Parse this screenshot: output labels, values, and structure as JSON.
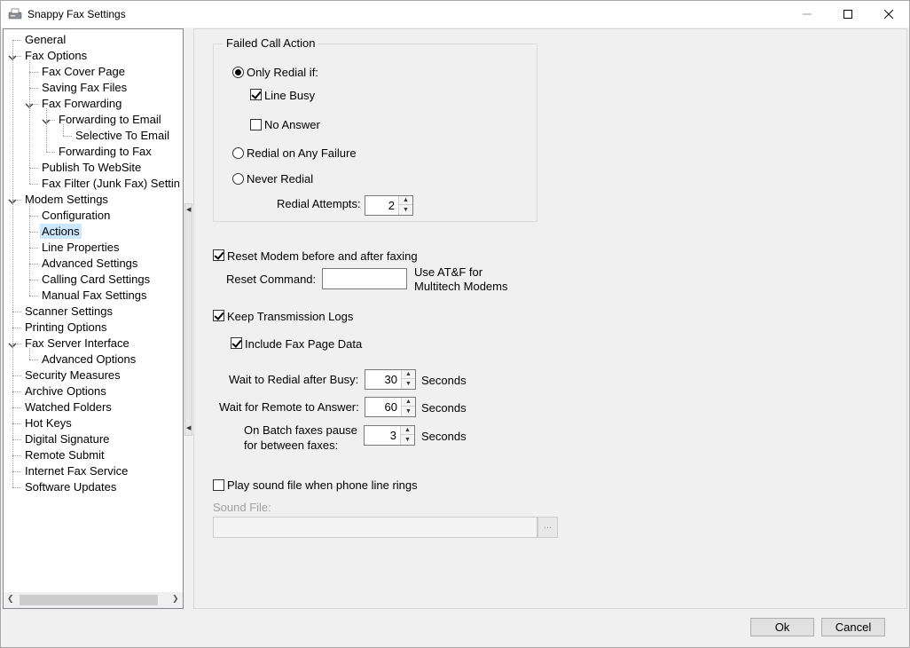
{
  "window": {
    "title": "Snappy Fax Settings",
    "minimize_glyph": "—",
    "maximize_glyph": "☐",
    "close_glyph": "✕"
  },
  "tree": {
    "items": [
      {
        "label": "General",
        "level": 0,
        "expanded": null,
        "selected": false
      },
      {
        "label": "Fax Options",
        "level": 0,
        "expanded": true,
        "selected": false
      },
      {
        "label": "Fax Cover Page",
        "level": 1,
        "expanded": null,
        "selected": false
      },
      {
        "label": "Saving Fax Files",
        "level": 1,
        "expanded": null,
        "selected": false
      },
      {
        "label": "Fax Forwarding",
        "level": 1,
        "expanded": true,
        "selected": false
      },
      {
        "label": "Forwarding to Email",
        "level": 2,
        "expanded": true,
        "selected": false
      },
      {
        "label": "Selective To Email",
        "level": 3,
        "expanded": null,
        "selected": false
      },
      {
        "label": "Forwarding to Fax",
        "level": 2,
        "expanded": null,
        "selected": false
      },
      {
        "label": "Publish To WebSite",
        "level": 1,
        "expanded": null,
        "selected": false
      },
      {
        "label": "Fax Filter (Junk Fax) Settin",
        "level": 1,
        "expanded": null,
        "selected": false
      },
      {
        "label": "Modem Settings",
        "level": 0,
        "expanded": true,
        "selected": false
      },
      {
        "label": "Configuration",
        "level": 1,
        "expanded": null,
        "selected": false
      },
      {
        "label": "Actions",
        "level": 1,
        "expanded": null,
        "selected": true
      },
      {
        "label": "Line Properties",
        "level": 1,
        "expanded": null,
        "selected": false
      },
      {
        "label": "Advanced Settings",
        "level": 1,
        "expanded": null,
        "selected": false
      },
      {
        "label": "Calling Card Settings",
        "level": 1,
        "expanded": null,
        "selected": false
      },
      {
        "label": "Manual Fax Settings",
        "level": 1,
        "expanded": null,
        "selected": false
      },
      {
        "label": "Scanner Settings",
        "level": 0,
        "expanded": null,
        "selected": false
      },
      {
        "label": "Printing Options",
        "level": 0,
        "expanded": null,
        "selected": false
      },
      {
        "label": "Fax Server Interface",
        "level": 0,
        "expanded": true,
        "selected": false
      },
      {
        "label": "Advanced Options",
        "level": 1,
        "expanded": null,
        "selected": false
      },
      {
        "label": "Security Measures",
        "level": 0,
        "expanded": null,
        "selected": false
      },
      {
        "label": "Archive Options",
        "level": 0,
        "expanded": null,
        "selected": false
      },
      {
        "label": "Watched Folders",
        "level": 0,
        "expanded": null,
        "selected": false
      },
      {
        "label": "Hot Keys",
        "level": 0,
        "expanded": null,
        "selected": false
      },
      {
        "label": "Digital Signature",
        "level": 0,
        "expanded": null,
        "selected": false
      },
      {
        "label": "Remote Submit",
        "level": 0,
        "expanded": null,
        "selected": false
      },
      {
        "label": "Internet Fax Service",
        "level": 0,
        "expanded": null,
        "selected": false
      },
      {
        "label": "Software Updates",
        "level": 0,
        "expanded": null,
        "selected": false
      }
    ]
  },
  "failed_call": {
    "title": "Failed Call Action",
    "only_redial_label": "Only Redial if:",
    "only_redial_selected": true,
    "line_busy_label": "Line Busy",
    "line_busy_checked": true,
    "no_answer_label": "No Answer",
    "no_answer_checked": false,
    "redial_any_label": "Redial on Any Failure",
    "redial_any_selected": false,
    "never_redial_label": "Never Redial",
    "never_redial_selected": false,
    "redial_attempts_label": "Redial Attempts:",
    "redial_attempts_value": "2"
  },
  "reset_modem": {
    "label": "Reset Modem before and after faxing",
    "checked": true,
    "command_label": "Reset Command:",
    "command_value": "",
    "hint_line1": "Use AT&F for",
    "hint_line2": "Multitech Modems"
  },
  "logs": {
    "keep_label": "Keep Transmission Logs",
    "keep_checked": true,
    "include_label": "Include Fax Page Data",
    "include_checked": true
  },
  "timing": {
    "wait_busy_label": "Wait to Redial after Busy:",
    "wait_busy_value": "30",
    "wait_remote_label": "Wait for Remote to Answer:",
    "wait_remote_value": "60",
    "batch_label_line1": "On Batch faxes pause",
    "batch_label_line2": "for between faxes:",
    "batch_value": "3",
    "seconds_label": "Seconds"
  },
  "sound": {
    "play_label": "Play sound file when phone line rings",
    "play_checked": false,
    "file_label": "Sound File:",
    "file_value": "",
    "browse_label": "..."
  },
  "buttons": {
    "ok_label": "Ok",
    "cancel_label": "Cancel"
  }
}
